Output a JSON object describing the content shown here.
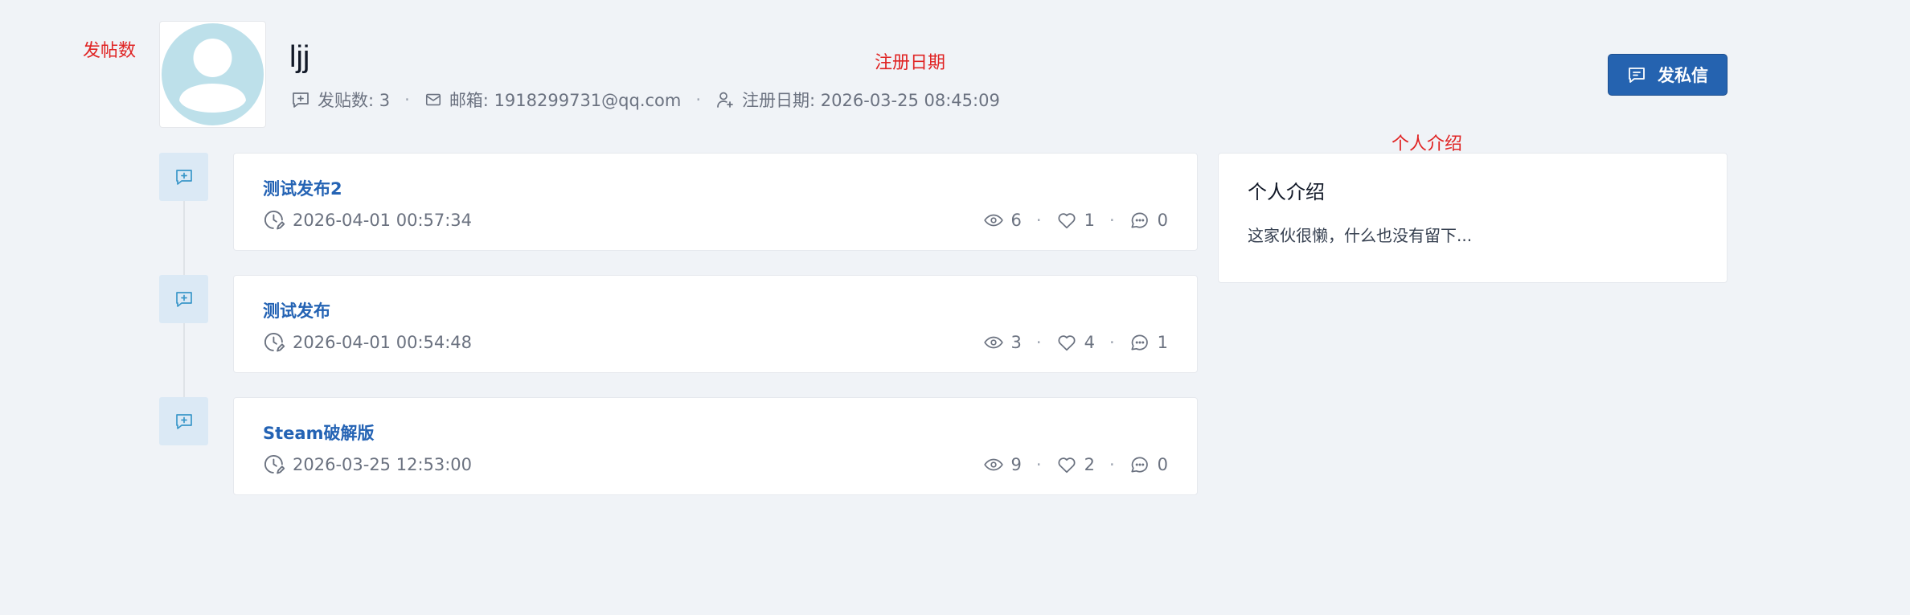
{
  "annotations": {
    "posts_count": "发帖数",
    "register_date": "注册日期",
    "intro": "个人介绍"
  },
  "profile": {
    "username": "ljj",
    "posts_label": "发贴数: 3",
    "email_label": "邮箱: 1918299731@qq.com",
    "register_label": "注册日期: 2026-03-25 08:45:09",
    "separator": "·",
    "pm_button_label": "发私信",
    "pm_button_color": "#2563b0"
  },
  "posts": [
    {
      "title": "测试发布2",
      "date": "2026-04-01 00:57:34",
      "views": "6",
      "likes": "1",
      "comments": "0"
    },
    {
      "title": "测试发布",
      "date": "2026-04-01 00:54:48",
      "views": "3",
      "likes": "4",
      "comments": "1"
    },
    {
      "title": "Steam破解版",
      "date": "2026-03-25 12:53:00",
      "views": "9",
      "likes": "2",
      "comments": "0"
    }
  ],
  "intro": {
    "title": "个人介绍",
    "text": "这家伙很懒，什么也没有留下..."
  },
  "colors": {
    "accent": "#2563b0",
    "link": "#2463b4",
    "annotation": "#e02424",
    "avatar": "#bde0ea"
  }
}
